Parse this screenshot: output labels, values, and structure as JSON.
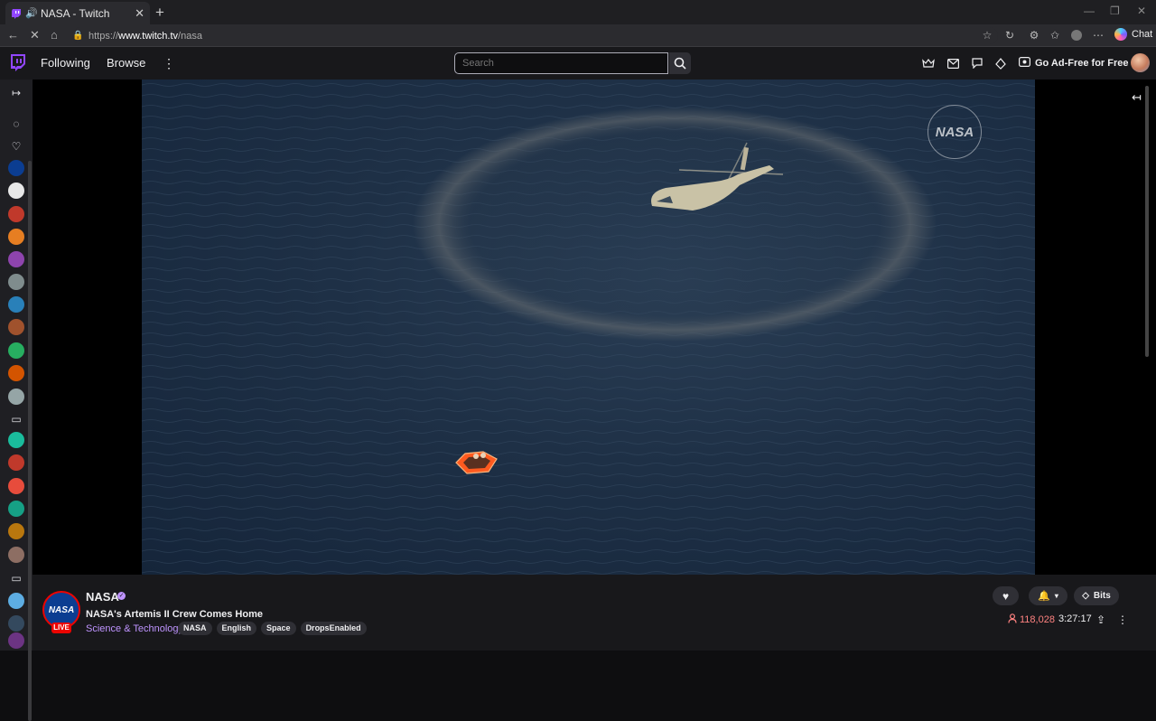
{
  "browser": {
    "tab_title": "NASA - Twitch",
    "url_prefix": "https://",
    "url_host": "www.twitch.tv",
    "url_path": "/nasa",
    "chat_label": "Chat"
  },
  "twitch_nav": {
    "following": "Following",
    "browse": "Browse",
    "search_placeholder": "Search",
    "ad_free": "Go Ad-Free for Free"
  },
  "stream": {
    "watermark": "NASA",
    "channel_name": "NASA",
    "avatar_text": "NASA",
    "live_label": "LIVE",
    "title": "NASA's Artemis II Crew Comes Home",
    "category": "Science & Technology",
    "tags": [
      "NASA",
      "English",
      "Space",
      "DropsEnabled"
    ],
    "viewers": "118,028",
    "uptime": "3:27:17",
    "bits_label": "Bits"
  },
  "sidebar_channels": [
    {
      "color": "#0b3d91"
    },
    {
      "color": "#e8e8e8"
    },
    {
      "color": "#c0392b"
    },
    {
      "color": "#e67e22"
    },
    {
      "color": "#8e44ad"
    },
    {
      "color": "#7f8c8d"
    },
    {
      "color": "#2980b9"
    },
    {
      "color": "#a0522d"
    },
    {
      "color": "#27ae60"
    },
    {
      "color": "#d35400"
    },
    {
      "color": "#95a5a6"
    },
    {
      "color": "#1abc9c"
    },
    {
      "color": "#c0392b"
    },
    {
      "color": "#e74c3c"
    },
    {
      "color": "#16a085"
    },
    {
      "color": "#b9770e"
    },
    {
      "color": "#8d6e63"
    },
    {
      "color": "#5dade2"
    },
    {
      "color": "#34495e"
    },
    {
      "color": "#6c3483"
    }
  ]
}
